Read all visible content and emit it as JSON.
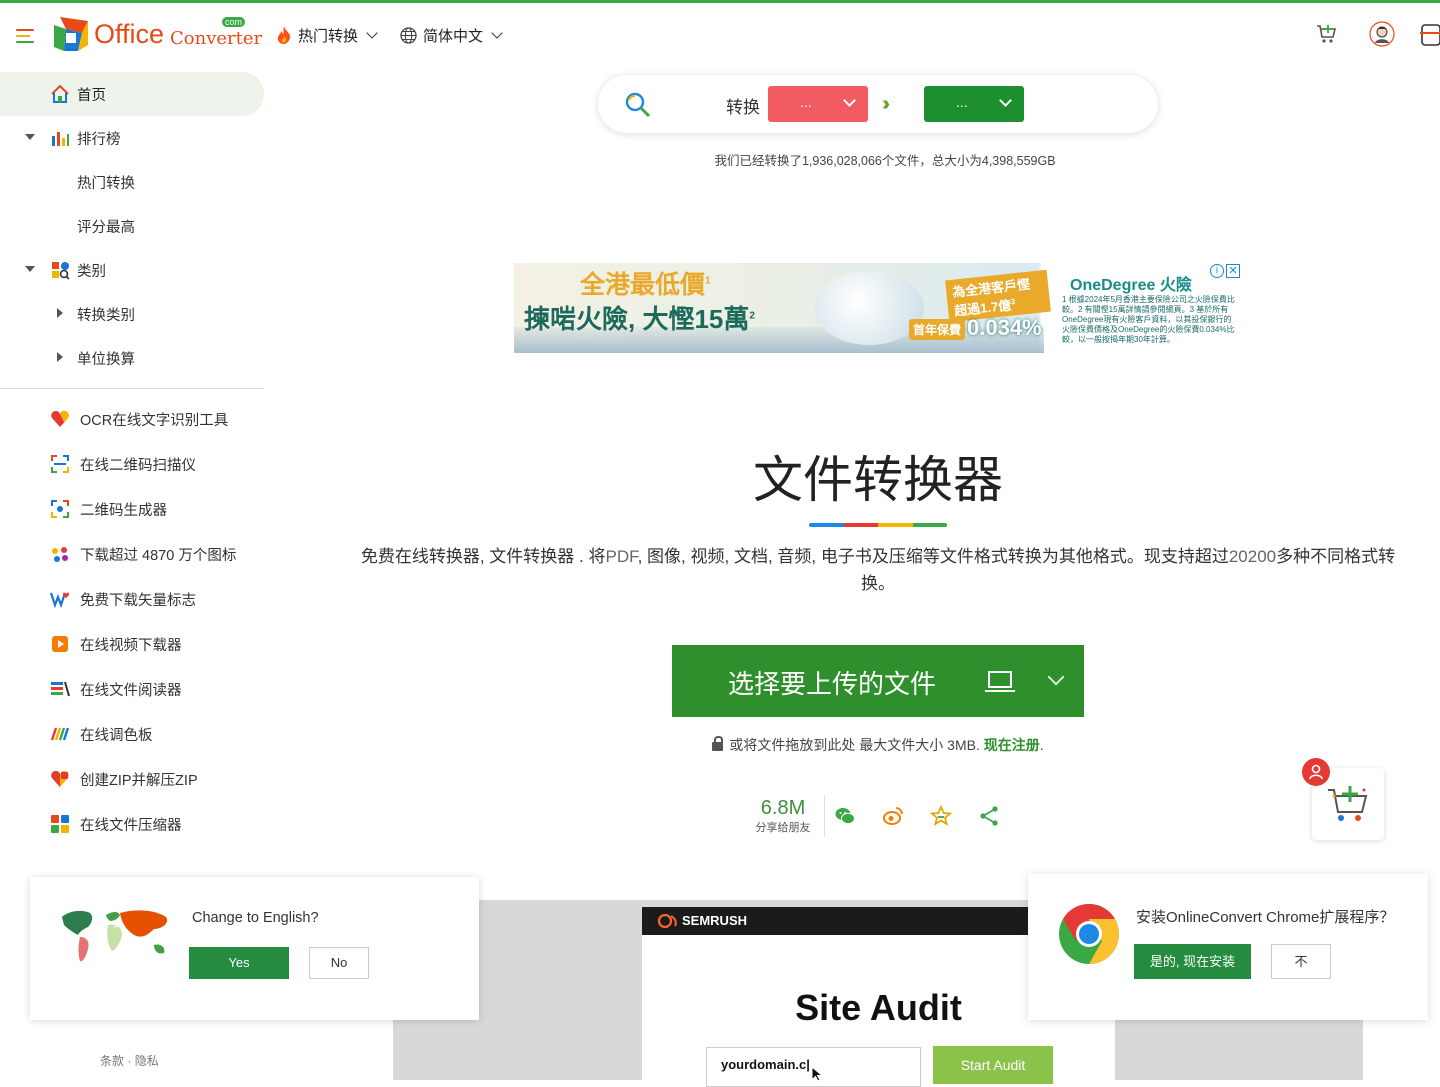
{
  "header": {
    "logo_office": "Office",
    "logo_converter": "Converter",
    "logo_com": "com",
    "hot_menu": "热门转换",
    "language_menu": "简体中文"
  },
  "sidebar": {
    "home": "首页",
    "rankings": "排行榜",
    "hot": "热门转换",
    "top_rated": "评分最高",
    "categories": "类别",
    "conversion_categories": "转换类别",
    "unit_conversion": "单位换算",
    "tools": [
      {
        "label": "OCR在线文字识别工具",
        "icon": "heart-icon"
      },
      {
        "label": "在线二维码扫描仪",
        "icon": "qr-scan-icon"
      },
      {
        "label": "二维码生成器",
        "icon": "qr-generate-icon"
      },
      {
        "label": "下载超过 4870 万个图标",
        "icon": "dots-icon"
      },
      {
        "label": "免费下载矢量标志",
        "icon": "vector-logo-icon"
      },
      {
        "label": "在线视频下载器",
        "icon": "video-download-icon"
      },
      {
        "label": "在线文件阅读器",
        "icon": "file-reader-icon"
      },
      {
        "label": "在线调色板",
        "icon": "palette-icon"
      },
      {
        "label": "创建ZIP并解压ZIP",
        "icon": "zip-icon"
      },
      {
        "label": "在线文件压缩器",
        "icon": "compressor-icon"
      }
    ]
  },
  "search": {
    "convert_label": "转换",
    "from_value": "...",
    "to_value": "..."
  },
  "stats_text": "我们已经转换了1,936,028,066个文件，总大小为4,398,559GB",
  "ad": {
    "line1": "全港最低價",
    "line1_sup": "1",
    "line2": "揀啱火險, 大慳15萬",
    "line2_sup": "2",
    "badge_top": "為全港客戶慳超過1.7億",
    "badge_top_sup": "3",
    "badge_label": "首年保費",
    "badge_rate": "0.034%",
    "brand": "OneDegree 火險",
    "fine_print": "1 根據2024年5月香港主要保險公司之火險保費比較。2 有關慳15萬詳情請參閱網頁。3 基於所有OneDegree現有火險客戶資料，以其投保銀行的火險保費價格及OneDegree的火險保費0.034%比較，以一般按揭年期30年計算。",
    "close": "✕",
    "info": "i"
  },
  "hero": {
    "title": "文件转换器",
    "desc_part1": "免费在线转换器, 文件转换器 . 将",
    "desc_pdf": "PDF",
    "desc_part2": ", 图像, 视频, 文档, 音频, 电子书及压缩等文件格式转换为其他格式。现支持超过",
    "desc_count": "20200",
    "desc_part3": "多种不同格式转换。",
    "upload_label": "选择要上传的文件",
    "drop_hint": "或将文件拖放到此处 最大文件大小 3MB.",
    "signup": "现在注册",
    "signup_dot": "."
  },
  "share": {
    "count": "6.8M",
    "sub": "分享给朋友"
  },
  "semrush": {
    "brand": "SEMRUSH",
    "title": "Site Audit",
    "input_value": "yourdomain.c|",
    "button": "Start Audit"
  },
  "lang_popup": {
    "question": "Change to English?",
    "yes": "Yes",
    "no": "No"
  },
  "chrome_popup": {
    "question": "安装OnlineConvert Chrome扩展程序？",
    "yes": "是的, 现在安装",
    "no": "不"
  },
  "footer": {
    "terms": "条款",
    "sep": "·",
    "privacy": "隐私"
  },
  "colors": {
    "brand_green": "#2f8f2c",
    "from_red": "#f25b62",
    "to_green": "#1e8f2e",
    "accent_orange": "#e64a19"
  }
}
